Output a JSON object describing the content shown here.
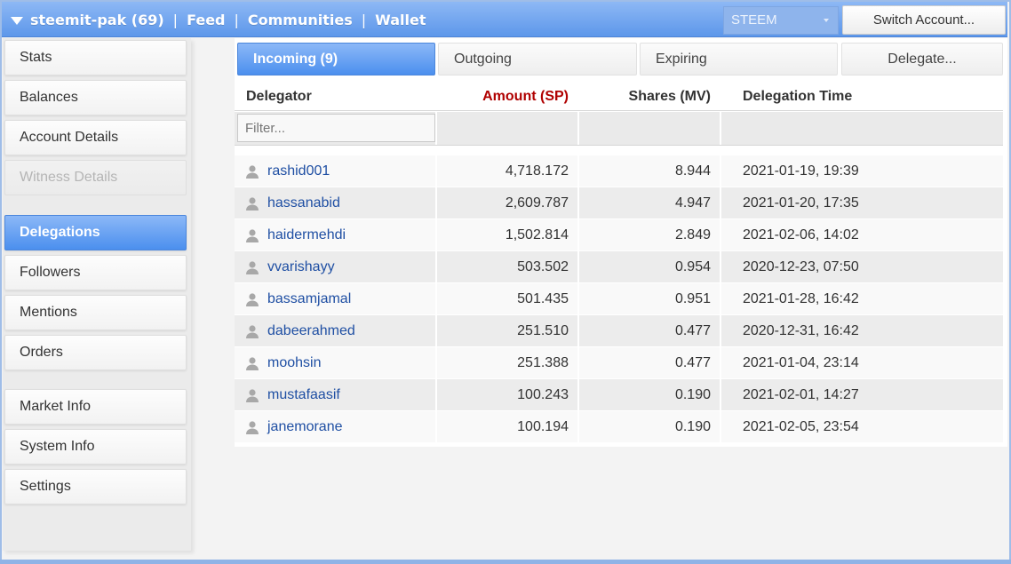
{
  "topbar": {
    "account": "steemit-pak (69)",
    "nav": [
      "Feed",
      "Communities",
      "Wallet"
    ],
    "currency_select": "STEEM",
    "switch_account": "Switch Account..."
  },
  "sidebar": {
    "items": [
      {
        "label": "Stats",
        "state": "normal"
      },
      {
        "label": "Balances",
        "state": "normal"
      },
      {
        "label": "Account Details",
        "state": "normal"
      },
      {
        "label": "Witness Details",
        "state": "disabled"
      },
      {
        "label": "Delegations",
        "state": "active"
      },
      {
        "label": "Followers",
        "state": "normal"
      },
      {
        "label": "Mentions",
        "state": "normal"
      },
      {
        "label": "Orders",
        "state": "normal"
      },
      {
        "label": "Market Info",
        "state": "normal"
      },
      {
        "label": "System Info",
        "state": "normal"
      },
      {
        "label": "Settings",
        "state": "normal"
      }
    ]
  },
  "tabs": [
    {
      "label": "Incoming (9)",
      "active": true
    },
    {
      "label": "Outgoing",
      "active": false
    },
    {
      "label": "Expiring",
      "active": false
    },
    {
      "label": "Delegate...",
      "active": false
    }
  ],
  "table": {
    "columns": [
      "Delegator",
      "Amount (SP)",
      "Shares (MV)",
      "Delegation Time"
    ],
    "sorted_column_color": "#b00000",
    "filter_placeholder": "Filter...",
    "rows": [
      {
        "delegator": "rashid001",
        "amount": "4,718.172",
        "shares": "8.944",
        "time": "2021-01-19, 19:39"
      },
      {
        "delegator": "hassanabid",
        "amount": "2,609.787",
        "shares": "4.947",
        "time": "2021-01-20, 17:35"
      },
      {
        "delegator": "haidermehdi",
        "amount": "1,502.814",
        "shares": "2.849",
        "time": "2021-02-06, 14:02"
      },
      {
        "delegator": "vvarishayy",
        "amount": "503.502",
        "shares": "0.954",
        "time": "2020-12-23, 07:50"
      },
      {
        "delegator": "bassamjamal",
        "amount": "501.435",
        "shares": "0.951",
        "time": "2021-01-28, 16:42"
      },
      {
        "delegator": "dabeerahmed",
        "amount": "251.510",
        "shares": "0.477",
        "time": "2020-12-31, 16:42"
      },
      {
        "delegator": "moohsin",
        "amount": "251.388",
        "shares": "0.477",
        "time": "2021-01-04, 23:14"
      },
      {
        "delegator": "mustafaasif",
        "amount": "100.243",
        "shares": "0.190",
        "time": "2021-02-01, 14:27"
      },
      {
        "delegator": "janemorane",
        "amount": "100.194",
        "shares": "0.190",
        "time": "2021-02-05, 23:54"
      }
    ]
  },
  "colors": {
    "accent": "#5d97ea",
    "link": "#1f4fa3",
    "sorted_header": "#b00000"
  }
}
